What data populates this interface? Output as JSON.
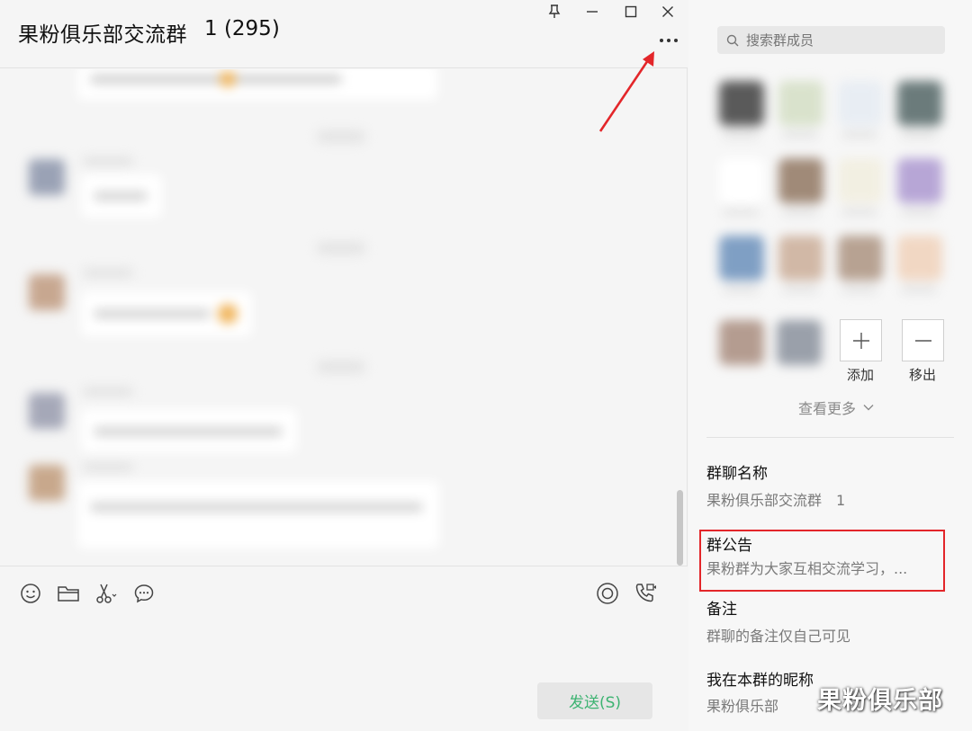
{
  "window": {
    "title": "果粉俱乐部交流群",
    "member_count": "1 (295)",
    "controls": [
      "pin-icon",
      "minimize-icon",
      "maximize-icon",
      "close-icon"
    ]
  },
  "composer": {
    "tools": [
      "emoji-icon",
      "folder-icon",
      "scissors-icon",
      "chat-history-icon"
    ],
    "right_tools": [
      "live-icon",
      "call-icon"
    ],
    "send_label": "发送(S)"
  },
  "side": {
    "search_placeholder": "搜索群成员",
    "add_label": "添加",
    "remove_label": "移出",
    "see_more": "查看更多",
    "group_name_label": "群聊名称",
    "group_name_value": "果粉俱乐部交流群　1",
    "notice_label": "群公告",
    "notice_value": "果粉群为大家互相交流学习，...",
    "remark_label": "备注",
    "remark_value": "群聊的备注仅自己可见",
    "nickname_label": "我在本群的昵称",
    "nickname_value": "果粉俱乐部"
  },
  "watermark": "果粉俱乐部",
  "colors": {
    "accent_green": "#3cb371",
    "annotation_red": "#e3262a",
    "background": "#f5f5f5"
  }
}
